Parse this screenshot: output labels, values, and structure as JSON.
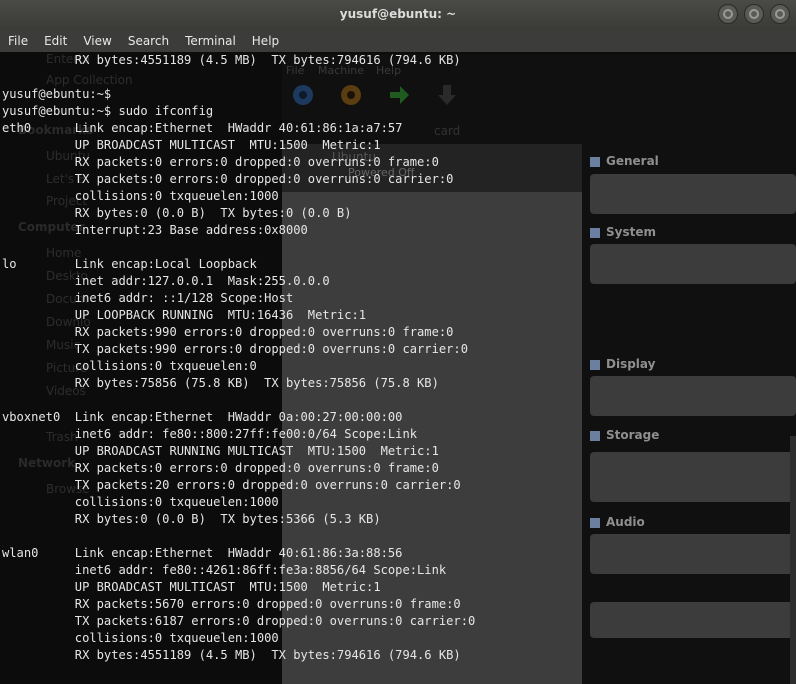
{
  "window": {
    "title": "yusuf@ebuntu: ~"
  },
  "menu": [
    "File",
    "Edit",
    "View",
    "Search",
    "Terminal",
    "Help"
  ],
  "terminal_lines": [
    "          RX bytes:4551189 (4.5 MB)  TX bytes:794616 (794.6 KB)",
    "",
    "yusuf@ebuntu:~$",
    "yusuf@ebuntu:~$ sudo ifconfig",
    "eth0      Link encap:Ethernet  HWaddr 40:61:86:1a:a7:57",
    "          UP BROADCAST MULTICAST  MTU:1500  Metric:1",
    "          RX packets:0 errors:0 dropped:0 overruns:0 frame:0",
    "          TX packets:0 errors:0 dropped:0 overruns:0 carrier:0",
    "          collisions:0 txqueuelen:1000",
    "          RX bytes:0 (0.0 B)  TX bytes:0 (0.0 B)",
    "          Interrupt:23 Base address:0x8000",
    "",
    "lo        Link encap:Local Loopback",
    "          inet addr:127.0.0.1  Mask:255.0.0.0",
    "          inet6 addr: ::1/128 Scope:Host",
    "          UP LOOPBACK RUNNING  MTU:16436  Metric:1",
    "          RX packets:990 errors:0 dropped:0 overruns:0 frame:0",
    "          TX packets:990 errors:0 dropped:0 overruns:0 carrier:0",
    "          collisions:0 txqueuelen:0",
    "          RX bytes:75856 (75.8 KB)  TX bytes:75856 (75.8 KB)",
    "",
    "vboxnet0  Link encap:Ethernet  HWaddr 0a:00:27:00:00:00",
    "          inet6 addr: fe80::800:27ff:fe00:0/64 Scope:Link",
    "          UP BROADCAST RUNNING MULTICAST  MTU:1500  Metric:1",
    "          RX packets:0 errors:0 dropped:0 overruns:0 frame:0",
    "          TX packets:20 errors:0 dropped:0 overruns:0 carrier:0",
    "          collisions:0 txqueuelen:1000",
    "          RX bytes:0 (0.0 B)  TX bytes:5366 (5.3 KB)",
    "",
    "wlan0     Link encap:Ethernet  HWaddr 40:61:86:3a:88:56",
    "          inet6 addr: fe80::4261:86ff:fe3a:8856/64 Scope:Link",
    "          UP BROADCAST MULTICAST  MTU:1500  Metric:1",
    "          RX packets:5670 errors:0 dropped:0 overruns:0 frame:0",
    "          TX packets:6187 errors:0 dropped:0 overruns:0 carrier:0",
    "          collisions:0 txqueuelen:1000",
    "          RX bytes:4551189 (4.5 MB)  TX bytes:794616 (794.6 KB)"
  ],
  "background": {
    "sidebar_items": [
      "Enterta",
      "App Collection",
      "Ubuntu",
      "Let's B",
      "Project",
      "Home",
      "Deskto",
      "Docum",
      "Downlo",
      "Music",
      "Picture",
      "Videos",
      "Trash",
      "Browse"
    ],
    "sidebar_headers": [
      "Bookmarks",
      "Computer",
      "Network"
    ],
    "vbox_menu": [
      "File",
      "Machine",
      "Help"
    ],
    "vbox_vm_status": "Powered Off",
    "vbox_vm_name": "Ubuntu",
    "vbox_sections": [
      "General",
      "System",
      "Display",
      "Storage",
      "Audio"
    ],
    "vbox_toolbar_hint": "card"
  },
  "colors": {
    "terminal_bg": "#0c0c0c",
    "terminal_fg": "#e6e6e6",
    "titlebar": "#3f3f3b"
  }
}
